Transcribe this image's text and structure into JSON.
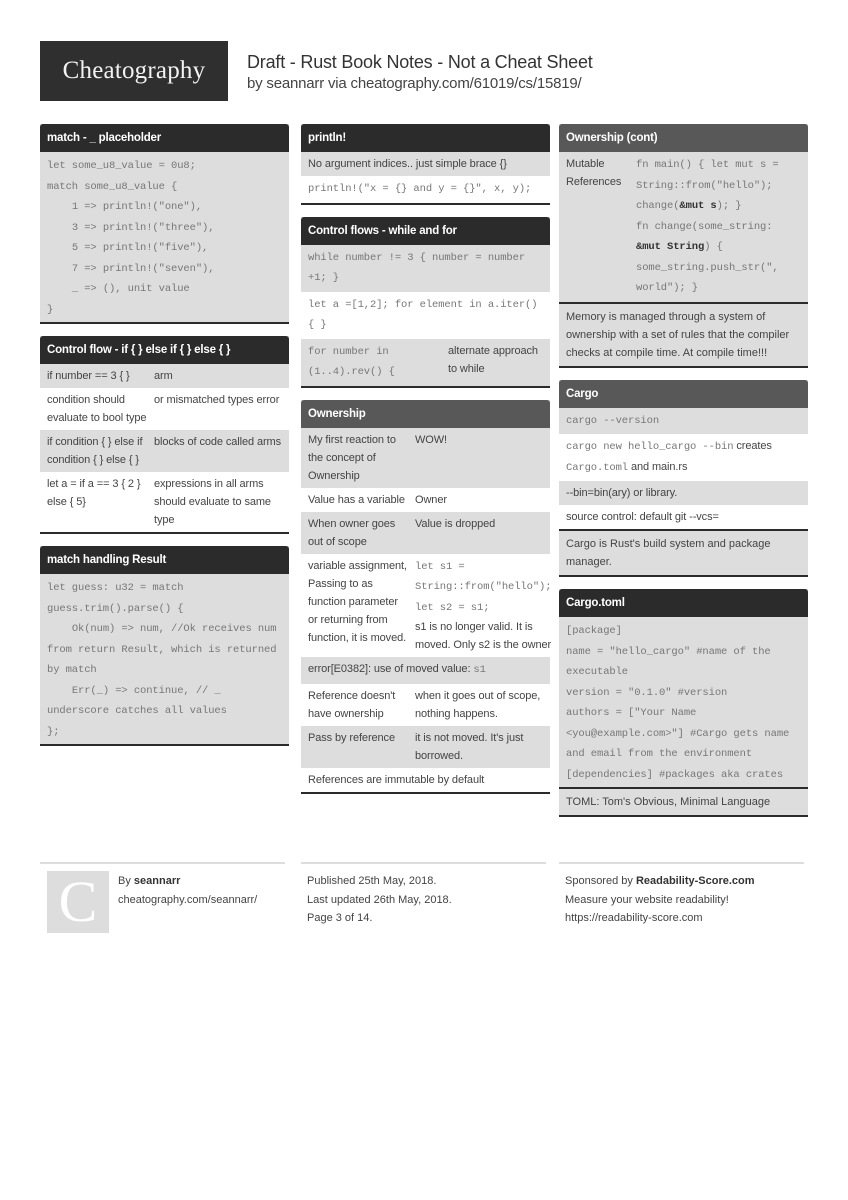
{
  "header": {
    "logo": "Cheatography",
    "title": "Draft - Rust Book Notes - Not a Cheat Sheet",
    "subtitle": "by seannarr via cheatography.com/61019/cs/15819/"
  },
  "sections": {
    "match_placeholder": {
      "title": "match - _ placeholder",
      "code": "let some_u8_value = 0u8;\nmatch some_u8_value {\n    1 => println!(\"one\"),\n    3 => println!(\"three\"),\n    5 => println!(\"five\"),\n    7 => println!(\"seven\"),\n    _ => (), unit value\n}"
    },
    "control_flow_if": {
      "title": "Control flow - if { } else if { } else { }",
      "rows": [
        {
          "k": "if number == 3 { }",
          "v": "arm"
        },
        {
          "k": "condition should evaluate to bool type",
          "v": "or mismatched types error"
        },
        {
          "k": "if condition { } else if condition { } else { }",
          "v": "blocks of code called arms"
        },
        {
          "k": "let a = if a == 3 { 2 } else { 5}",
          "v": "expressions in all arms should evaluate to same type"
        }
      ]
    },
    "match_result": {
      "title": "match handling Result",
      "code": "let guess: u32 = match guess.trim().parse() {\n    Ok(num) => num, //Ok receives num from return Result, which is returned by match\n    Err(_) => continue, // _ underscore catches all values\n};"
    },
    "println": {
      "title": "println!",
      "row1": "No argument indices.. just simple brace {}",
      "row2": "println!(\"x = {} and y = {}\", x, y);"
    },
    "control_flows_while": {
      "title": "Control flows - while and for",
      "row1": "while number != 3 { number = number +1; }",
      "row2": "let a =[1,2]; for element in a.iter() { }",
      "row3_k": "for number in (1..4).rev() {",
      "row3_v": "alternate approach to while"
    },
    "ownership": {
      "title": "Ownership",
      "rows": [
        {
          "k": "My first reaction to the concept of Ownership",
          "v": "WOW!"
        },
        {
          "k": "Value has a variable",
          "v": "Owner"
        },
        {
          "k": "When owner goes out of scope",
          "v": "Value is dropped"
        }
      ],
      "move_k": "variable assignment, Passing to as function parameter or returning from function, it is moved.",
      "move_code": "let s1 = String::from(\"hello\"); let s2 = s1;",
      "move_text": "s1 is no longer valid. It is moved. Only s2 is the owner",
      "error_text": "error[E0382]: use of moved value: ",
      "error_code": "s1",
      "rows2": [
        {
          "k": "Reference doesn't have ownership",
          "v": "when it goes out of scope, nothing happens."
        },
        {
          "k": "Pass by reference",
          "v": "it is not moved. It's just borrowed."
        }
      ],
      "last": "References are immutable by default"
    },
    "ownership_cont": {
      "title": "Ownership (cont)",
      "k": "Mutable References",
      "code1": "fn main() { let mut s = String::from(\"hello\"); change(",
      "code1b": "&mut s",
      "code2": "); }\nfn change(some_string: ",
      "code2b": "&mut String",
      "code3": ") { some_string.push_str(\", world\"); }",
      "note": "Memory is managed through a system of ownership with a set of rules that the compiler checks at compile time. At compile time!!!"
    },
    "cargo": {
      "title": "Cargo",
      "row1": "cargo --version",
      "row2_code": "cargo new hello_cargo --bin",
      "row2_text": " creates ",
      "row2_code2": "Cargo.toml",
      "row2_text2": " and main.rs",
      "row3": "--bin=bin(ary) or library.",
      "row4": "source control: default git --vcs=",
      "note": "Cargo is Rust's build system and package manager."
    },
    "cargo_toml": {
      "title": "Cargo.toml",
      "code": "[package]\nname = \"hello_cargo\" #name of the executable\nversion = \"0.1.0\" #version\nauthors = [\"Your Name <you@example.com>\"] #Cargo gets name and email from the environment\n[dependencies] #packages aka crates",
      "note": "TOML: Tom's Obvious, Minimal Language"
    }
  },
  "footer": {
    "avatar_letter": "C",
    "by_label": "By ",
    "author": "seannarr",
    "author_url": "cheatography.com/seannarr/",
    "published": "Published 25th May, 2018.",
    "updated": "Last updated 26th May, 2018.",
    "page": "Page 3 of 14.",
    "sponsored_label": "Sponsored by ",
    "sponsor": "Readability-Score.com",
    "sponsor_tagline": "Measure your website readability!",
    "sponsor_url": "https://readability-score.com"
  }
}
